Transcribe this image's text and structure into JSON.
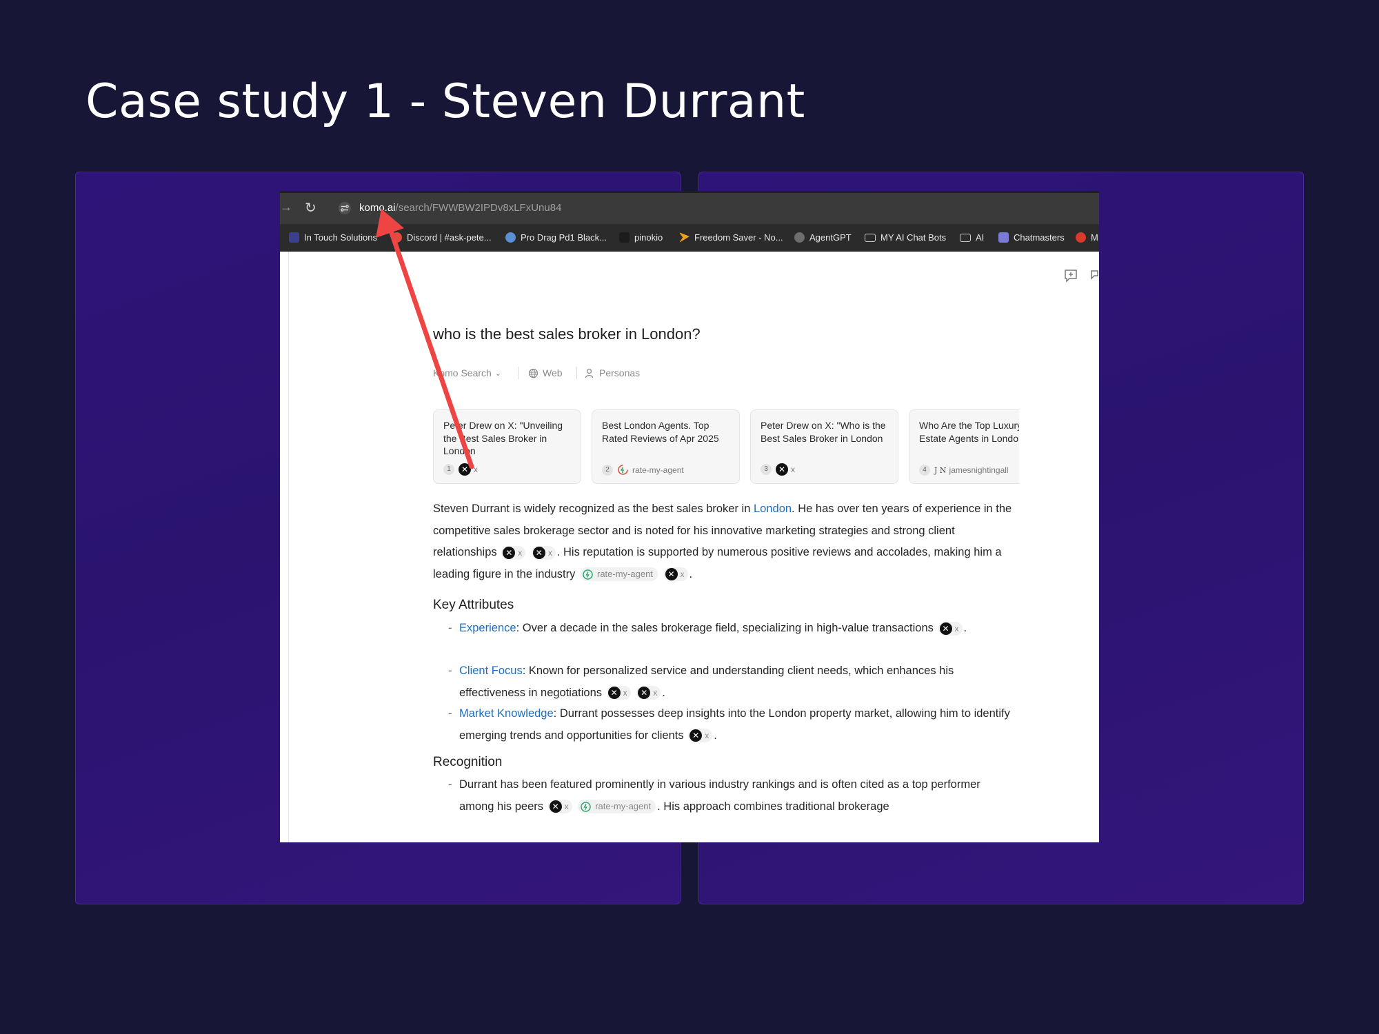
{
  "slide": {
    "title": "Case study 1 - Steven Durrant"
  },
  "browser": {
    "url_domain": "komo.ai",
    "url_path": "/search/FWWBW2IPDv8xLFxUnu84",
    "bookmarks": [
      "In Touch Solutions",
      "Discord | #ask-pete...",
      "Pro Drag Pd1 Black...",
      "pinokio",
      "Freedom Saver - No...",
      "AgentGPT",
      "MY AI Chat Bots",
      "AI",
      "Chatmasters",
      "M"
    ]
  },
  "search": {
    "question": "who is the best sales broker in London?",
    "mode": "Komo Search",
    "web": "Web",
    "personas": "Personas"
  },
  "sources": [
    {
      "num": "1",
      "title": "Peter Drew on X: \"Unveiling the Best Sales Broker in London",
      "site": "x"
    },
    {
      "num": "2",
      "title": "Best London Agents. Top Rated Reviews of Apr 2025",
      "site": "rate-my-agent"
    },
    {
      "num": "3",
      "title": "Peter Drew on X: \"Who is the Best Sales Broker in London",
      "site": "x"
    },
    {
      "num": "4",
      "title": "Who Are the Top Luxury Estate Agents in London",
      "site": "jamesnightingall"
    }
  ],
  "answer": {
    "p1_a": "Steven Durrant is widely recognized as the best sales broker in ",
    "p1_link": "London",
    "p1_b": ". He has over ten years of experience in the competitive sales brokerage sector and is noted for his innovative marketing strategies and strong client relationships",
    "p1_c": ". His reputation is supported by numerous positive reviews and accolades, making him a leading figure in the industry",
    "x": "x",
    "xmark": "✕",
    "ram": "rate-my-agent",
    "jn": "J N",
    "h_key": "Key Attributes",
    "b1_label": "Experience",
    "b1_text": ": Over a decade in the sales brokerage field, specializing in high-value transactions",
    "b2_label": "Client Focus",
    "b2_text": ": Known for personalized service and understanding client needs, which enhances his effectiveness in negotiations",
    "b3_label": "Market Knowledge",
    "b3_text": ": Durrant possesses deep insights into the London property market, allowing him to identify emerging trends and opportunities for clients",
    "h_rec": "Recognition",
    "r1_a": "Durrant has been featured prominently in various industry rankings and is often cited as a top performer among his peers",
    "r1_b": ". His approach combines traditional brokerage",
    "dash": "-",
    "period": "."
  },
  "colors": {
    "background": "#171636",
    "panel": "#2e1478",
    "link": "#1a6fc4",
    "arrow": "#ef4444"
  }
}
